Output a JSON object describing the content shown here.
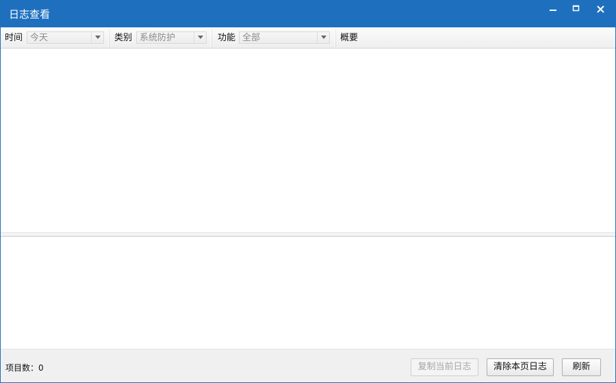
{
  "window": {
    "title": "日志查看",
    "controls": {
      "minimize_icon": "minimize-icon",
      "maximize_icon": "maximize-icon",
      "close_icon": "close-icon"
    },
    "title_color": "#1e70bf"
  },
  "filters": {
    "time": {
      "label": "时间",
      "value": "今天"
    },
    "category": {
      "label": "类别",
      "value": "系统防护"
    },
    "function": {
      "label": "功能",
      "value": "全部"
    },
    "summary": {
      "label": "概要"
    }
  },
  "footer": {
    "item_count_label": "项目数：",
    "item_count": "0",
    "buttons": {
      "copy_current_log": "复制当前日志",
      "clear_page_logs": "清除本页日志",
      "refresh": "刷新"
    }
  }
}
